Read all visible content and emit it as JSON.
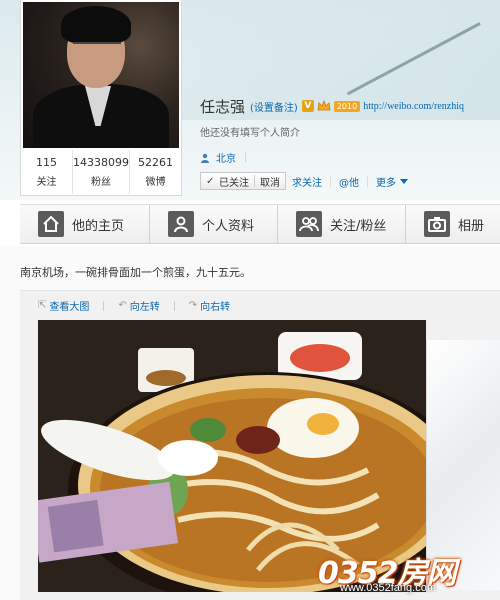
{
  "profile": {
    "name": "任志强",
    "remark_link": "(设置备注)",
    "badge_v": "V",
    "badge_vip": "2010",
    "url": "http://weibo.com/renzhiq",
    "bio": "他还没有填写个人简介",
    "location": "北京",
    "stats": [
      {
        "value": "115",
        "label": "关注"
      },
      {
        "value": "14338099",
        "label": "粉丝"
      },
      {
        "value": "52261",
        "label": "微博"
      }
    ],
    "actions": {
      "followed_label": "已关注",
      "cancel_label": "取消",
      "follow_him_label": "求关注",
      "at_him_label": "@他",
      "more_label": "更多"
    }
  },
  "tabs": [
    {
      "label": "他的主页",
      "icon": "home-icon"
    },
    {
      "label": "个人资料",
      "icon": "profile-icon"
    },
    {
      "label": "关注/粉丝",
      "icon": "follow-icon"
    },
    {
      "label": "相册",
      "icon": "camera-icon"
    }
  ],
  "post": {
    "text": "南京机场，一碗排骨面加一个煎蛋，九十五元。",
    "toolbar": {
      "view_large": "查看大图",
      "rotate_left": "向左转",
      "rotate_right": "向右转"
    }
  },
  "watermark": {
    "logo": "0352房网",
    "url": "www.0352fang.com"
  },
  "colors": {
    "link": "#0a67b0",
    "text": "#333333",
    "vip": "#f5a623",
    "tab_icon": "#5b5b5b"
  }
}
